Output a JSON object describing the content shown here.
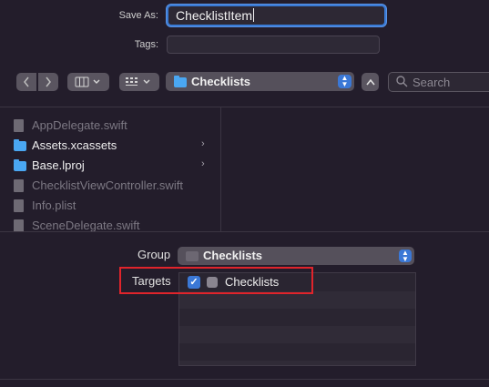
{
  "save_as": {
    "label": "Save As:",
    "value": "ChecklistItem"
  },
  "tags": {
    "label": "Tags:",
    "value": ""
  },
  "toolbar": {
    "back_icon": "chevron-left",
    "forward_icon": "chevron-right",
    "view_icon": "column-view",
    "group_icon": "grid-view",
    "location": "Checklists",
    "search_placeholder": "Search"
  },
  "files": [
    {
      "name": "AppDelegate.swift",
      "type": "file",
      "enabled": false
    },
    {
      "name": "Assets.xcassets",
      "type": "folder",
      "enabled": true
    },
    {
      "name": "Base.lproj",
      "type": "folder",
      "enabled": true
    },
    {
      "name": "ChecklistViewController.swift",
      "type": "file",
      "enabled": false
    },
    {
      "name": "Info.plist",
      "type": "file",
      "enabled": false
    },
    {
      "name": "SceneDelegate.swift",
      "type": "file",
      "enabled": false
    }
  ],
  "group": {
    "label": "Group",
    "value": "Checklists"
  },
  "targets": {
    "label": "Targets",
    "items": [
      {
        "name": "Checklists",
        "checked": true
      }
    ]
  },
  "colors": {
    "accent": "#3b78d6",
    "folder": "#4aa7f2",
    "highlight_box": "#e0242b"
  }
}
